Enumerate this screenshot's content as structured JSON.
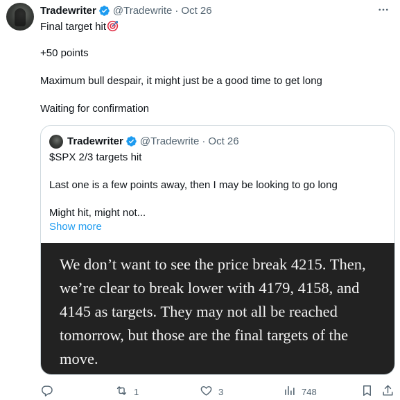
{
  "tweet": {
    "author_name": "Tradewriter",
    "handle": "@Tradewrite",
    "separator": "·",
    "date": "Oct 26",
    "lines": [
      "Final target hit",
      "+50 points",
      "Maximum bull despair, it might just be a good time to get long",
      "Waiting for confirmation"
    ]
  },
  "quote": {
    "author_name": "Tradewriter",
    "handle": "@Tradewrite",
    "separator": "·",
    "date": "Oct 26",
    "lines": [
      "$SPX 2/3 targets hit",
      "Last one is a few points away, then I may be looking to go long",
      "Might hit, might not..."
    ],
    "show_more": "Show more",
    "image_text": "We don’t want to see the price break 4215. Then, we’re clear to break lower with 4179, 4158, and 4145 as targets. They may not all be reached tomorrow, but those are the final targets of the move."
  },
  "actions": {
    "reply": {
      "icon": "reply-icon",
      "count": ""
    },
    "retweet": {
      "icon": "retweet-icon",
      "count": "1"
    },
    "like": {
      "icon": "heart-icon",
      "count": "3"
    },
    "views": {
      "icon": "views-icon",
      "count": "748"
    },
    "bookmark": {
      "icon": "bookmark-icon",
      "count": ""
    },
    "share": {
      "icon": "share-icon",
      "count": ""
    }
  },
  "colors": {
    "verified": "#1d9bf0",
    "secondary_text": "#536471",
    "link": "#1d9bf0",
    "image_background": "#222222"
  }
}
